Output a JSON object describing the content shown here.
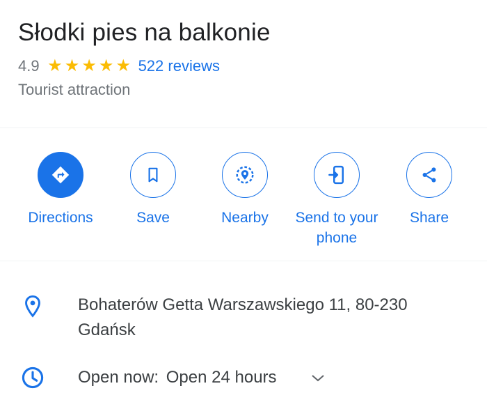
{
  "place": {
    "title": "Słodki pies na balkonie",
    "rating": "4.9",
    "stars": 5,
    "reviews": "522 reviews",
    "category": "Tourist attraction"
  },
  "actions": [
    {
      "label": "Directions",
      "icon": "directions-icon"
    },
    {
      "label": "Save",
      "icon": "bookmark-icon"
    },
    {
      "label": "Nearby",
      "icon": "nearby-icon"
    },
    {
      "label": "Send to your phone",
      "icon": "send-to-phone-icon"
    },
    {
      "label": "Share",
      "icon": "share-icon"
    }
  ],
  "info": {
    "address": "Bohaterów Getta Warszawskiego 11, 80-230 Gdańsk",
    "address_line1": "Bohaterów Getta Warszawskiego 11, 80-230",
    "address_line2": "Gdańsk",
    "hours_label": "Open now:",
    "hours_value": "Open 24 hours"
  },
  "colors": {
    "accent": "#1a73e8",
    "star": "#fbbc04",
    "secondary_text": "#70757a"
  }
}
